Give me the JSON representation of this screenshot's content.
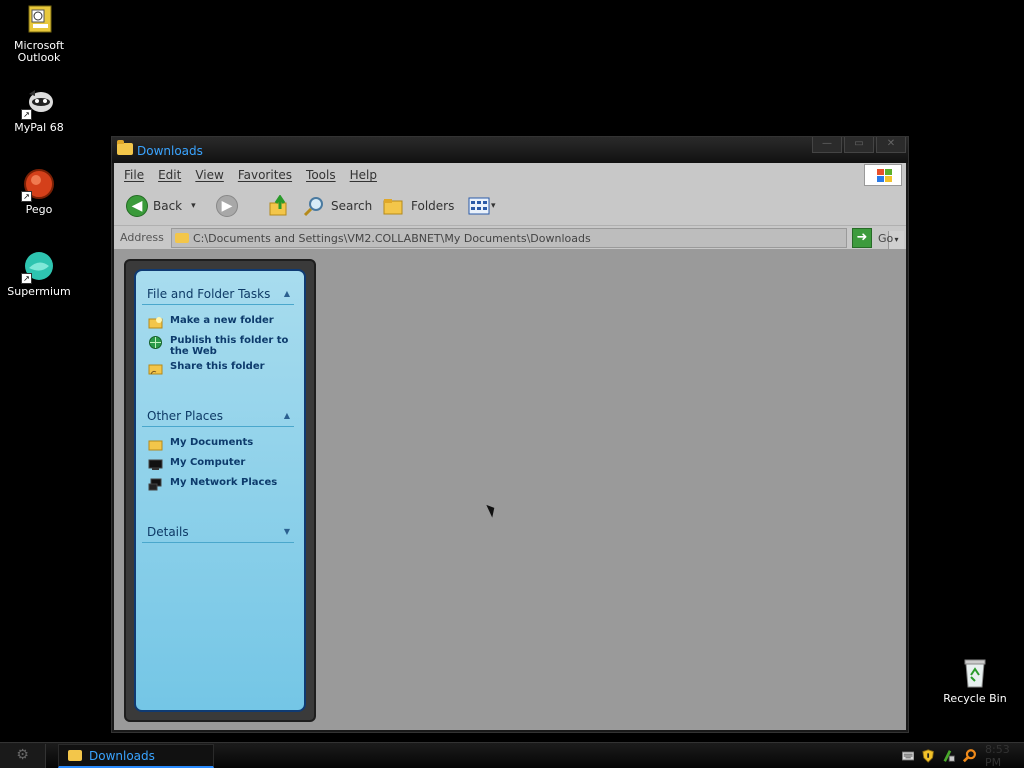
{
  "desktop": {
    "icons": [
      {
        "label": "Microsoft Outlook",
        "icon": "outlook-icon"
      },
      {
        "label": "MyPal 68",
        "icon": "mypal-icon"
      },
      {
        "label": "Pego",
        "icon": "pego-icon"
      },
      {
        "label": "Supermium",
        "icon": "supermium-icon"
      },
      {
        "label": "Recycle Bin",
        "icon": "recycle-bin-icon"
      }
    ],
    "shortcut_arrow": "↗"
  },
  "window": {
    "title": "Downloads",
    "controls": {
      "minimize": "—",
      "maximize": "▭",
      "close": "✕"
    },
    "menu": [
      "File",
      "Edit",
      "View",
      "Favorites",
      "Tools",
      "Help"
    ],
    "toolbar": {
      "back": "Back",
      "search": "Search",
      "folders": "Folders",
      "dropdown_glyph": "▾"
    },
    "address": {
      "label": "Address",
      "value": "C:\\Documents and Settings\\VM2.COLLABNET\\My Documents\\Downloads",
      "go": "Go",
      "dropdown_glyph": "▾"
    },
    "task_pane": {
      "file_folder_tasks": {
        "title": "File and Folder Tasks",
        "items": [
          "Make a new folder",
          "Publish this folder to the Web",
          "Share this folder"
        ]
      },
      "other_places": {
        "title": "Other Places",
        "items": [
          "My Documents",
          "My Computer",
          "My Network Places"
        ]
      },
      "details": {
        "title": "Details"
      },
      "collapse_glyph": "▲",
      "expand_glyph": "▼"
    }
  },
  "taskbar": {
    "start_glyph": "⚙",
    "buttons": [
      {
        "label": "Downloads"
      }
    ],
    "clock": "8:53 PM"
  },
  "colors": {
    "title_text": "#3aa4ff",
    "task_pane_top": "#a8dcee",
    "task_pane_bottom": "#74c6e6",
    "task_text": "#0d3b6c",
    "content_bg": "#9a9a9a"
  }
}
